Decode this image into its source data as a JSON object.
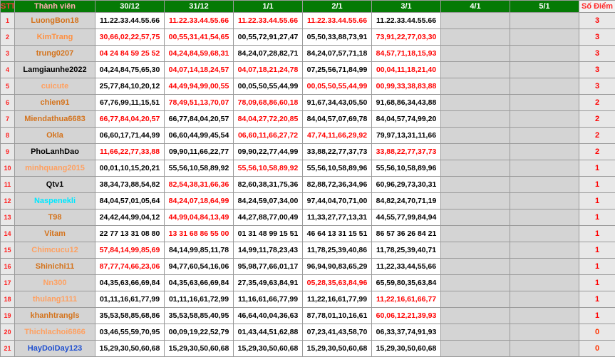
{
  "headers": {
    "stt": "STT",
    "name": "Thành viên",
    "dates": [
      "30/12",
      "31/12",
      "1/1",
      "2/1",
      "3/1",
      "4/1",
      "5/1"
    ],
    "score": "Số Điểm"
  },
  "rows": [
    {
      "stt": "1",
      "name": "LuongBon18",
      "nameColor": "#d4731c",
      "values": [
        "11.22.33.44.55.66",
        "11.22.33.44.55.66",
        "11.22.33.44.55.66",
        "11.22.33.44.55.66",
        "11.22.33.44.55.66"
      ],
      "red": [
        false,
        true,
        true,
        true,
        false
      ],
      "score": "3"
    },
    {
      "stt": "2",
      "name": "KimTrang",
      "nameColor": "#ff9040",
      "values": [
        "30,66,02,22,57,75",
        "00,55,31,41,54,65",
        "00,55,72,91,27,47",
        "05,50,33,88,73,91",
        "73,91,22,77,03,30"
      ],
      "red": [
        true,
        true,
        false,
        false,
        true
      ],
      "score": "3"
    },
    {
      "stt": "3",
      "name": "trung0207",
      "nameColor": "#d4731c",
      "values": [
        "04 24 84 59 25 52",
        "04,24,84,59,68,31",
        "84,24,07,28,82,71",
        "84,24,07,57,71,18",
        "84,57,71,18,15,93"
      ],
      "red": [
        true,
        true,
        false,
        false,
        true
      ],
      "score": "3"
    },
    {
      "stt": "4",
      "name": "Lamgiaunhe2022",
      "nameColor": "#000000",
      "values": [
        "04,24,84,75,65,30",
        "04,07,14,18,24,57",
        "04,07,18,21,24,78",
        "07,25,56,71,84,99",
        "00,04,11,18,21,40"
      ],
      "red": [
        false,
        true,
        true,
        false,
        true
      ],
      "score": "3"
    },
    {
      "stt": "5",
      "name": "cuicute",
      "nameColor": "#ffa060",
      "values": [
        "25,77,84,10,20,12",
        "44,49,94,99,00,55",
        "00,05,50,55,44,99",
        "00,05,50,55,44,99",
        "00,99,33,38,83,88"
      ],
      "red": [
        false,
        true,
        false,
        true,
        true
      ],
      "score": "3"
    },
    {
      "stt": "6",
      "name": "chien91",
      "nameColor": "#d4731c",
      "values": [
        "67,76,99,11,15,51",
        "78,49,51,13,70,07",
        "78,09,68,86,60,18",
        "91,67,34,43,05,50",
        "91,68,86,34,43,88"
      ],
      "red": [
        false,
        true,
        true,
        false,
        false
      ],
      "score": "2"
    },
    {
      "stt": "7",
      "name": "Miendathua6683",
      "nameColor": "#d4731c",
      "values": [
        "66,77,84,04,20,57",
        "66,77,84,04,20,57",
        "84,04,27,72,20,85",
        "84,04,57,07,69,78",
        "84,04,57,74,99,20"
      ],
      "red": [
        true,
        false,
        true,
        false,
        false
      ],
      "score": "2"
    },
    {
      "stt": "8",
      "name": "Okla",
      "nameColor": "#d4731c",
      "values": [
        "06,60,17,71,44,99",
        "06,60,44,99,45,54",
        "06,60,11,66,27,72",
        "47,74,11,66,29,92",
        "79,97,13,31,11,66"
      ],
      "red": [
        false,
        false,
        true,
        true,
        false
      ],
      "score": "2"
    },
    {
      "stt": "9",
      "name": "PhoLanhDao",
      "nameColor": "#000000",
      "values": [
        "11,66,22,77,33,88",
        "09,90,11,66,22,77",
        "09,90,22,77,44,99",
        "33,88,22,77,37,73",
        "33,88,22,77,37,73"
      ],
      "red": [
        true,
        false,
        false,
        false,
        true
      ],
      "score": "2"
    },
    {
      "stt": "10",
      "name": "minhquang2015",
      "nameColor": "#ffa060",
      "values": [
        "00,01,10,15,20,21",
        "55,56,10,58,89,92",
        "55,56,10,58,89,92",
        "55,56,10,58,89,96",
        "55,56,10,58,89,96"
      ],
      "red": [
        false,
        false,
        true,
        false,
        false
      ],
      "score": "1"
    },
    {
      "stt": "11",
      "name": "Qtv1",
      "nameColor": "#000000",
      "values": [
        "38,34,73,88,54,82",
        "82,54,38,31,66,36",
        "82,60,38,31,75,36",
        "82,88,72,36,34,96",
        "60,96,29,73,30,31"
      ],
      "red": [
        false,
        true,
        false,
        false,
        false
      ],
      "score": "1"
    },
    {
      "stt": "12",
      "name": "Naspenekli",
      "nameColor": "#00e8ff",
      "values": [
        "84,04,57,01,05,64",
        "84,24,07,18,64,99",
        "84,24,59,07,34,00",
        "97,44,04,70,71,00",
        "84,82,24,70,71,19"
      ],
      "red": [
        false,
        true,
        false,
        false,
        false
      ],
      "score": "1"
    },
    {
      "stt": "13",
      "name": "T98",
      "nameColor": "#d4731c",
      "values": [
        "24,42,44,99,04,12",
        "44,99,04,84,13,49",
        "44,27,88,77,00,49",
        "11,33,27,77,13,31",
        "44,55,77,99,84,94"
      ],
      "red": [
        false,
        true,
        false,
        false,
        false
      ],
      "score": "1"
    },
    {
      "stt": "14",
      "name": "Vitam",
      "nameColor": "#d4731c",
      "values": [
        "22 77 13 31 08 80",
        "13 31 68 86 55 00",
        "01 31 48 99 15 51",
        "46 64 13 31 15 51",
        "86 57 36 26 84 21"
      ],
      "red": [
        false,
        true,
        false,
        false,
        false
      ],
      "score": "1"
    },
    {
      "stt": "15",
      "name": "Chimcucu12",
      "nameColor": "#ffa060",
      "values": [
        "57,84,14,99,85,69",
        "84,14,99,85,11,78",
        "14,99,11,78,23,43",
        "11,78,25,39,40,86",
        "11,78,25,39,40,71"
      ],
      "red": [
        true,
        false,
        false,
        false,
        false
      ],
      "score": "1"
    },
    {
      "stt": "16",
      "name": "Shinichi11",
      "nameColor": "#d4731c",
      "values": [
        "87,77,74,66,23,06",
        "94,77,60,54,16,06",
        "95,98,77,66,01,17",
        "96,94,90,83,65,29",
        "11,22,33,44,55,66"
      ],
      "red": [
        true,
        false,
        false,
        false,
        false
      ],
      "score": "1"
    },
    {
      "stt": "17",
      "name": "Nn300",
      "nameColor": "#ffa060",
      "values": [
        "04,35,63,66,69,84",
        "04,35,63,66,69,84",
        "27,35,49,63,84,91",
        "05,28,35,63,84,96",
        "65,59,80,35,63,84"
      ],
      "red": [
        false,
        false,
        false,
        true,
        false
      ],
      "score": "1"
    },
    {
      "stt": "18",
      "name": "thulang1111",
      "nameColor": "#ffa060",
      "values": [
        "01,11,16,61,77,99",
        "01,11,16,61,72,99",
        "11,16,61,66,77,99",
        "11,22,16,61,77,99",
        "11,22,16,61,66,77"
      ],
      "red": [
        false,
        false,
        false,
        false,
        true
      ],
      "score": "1"
    },
    {
      "stt": "19",
      "name": "khanhtrangls",
      "nameColor": "#d4731c",
      "values": [
        "35,53,58,85,68,86",
        "35,53,58,85,40,95",
        "46,64,40,04,36,63",
        "87,78,01,10,16,61",
        "60,06,12,21,39,93"
      ],
      "red": [
        false,
        false,
        false,
        false,
        true
      ],
      "score": "1"
    },
    {
      "stt": "20",
      "name": "Thichlachoi6866",
      "nameColor": "#ffa060",
      "values": [
        "03,46,55,59,70,95",
        "00,09,19,22,52,79",
        "01,43,44,51,62,88",
        "07,23,41,43,58,70",
        "06,33,37,74,91,93"
      ],
      "red": [
        false,
        false,
        false,
        false,
        false
      ],
      "score": "0"
    },
    {
      "stt": "21",
      "name": "HayDoiDay123",
      "nameColor": "#2050d0",
      "values": [
        "15,29,30,50,60,68",
        "15,29,30,50,60,68",
        "15,29,30,50,60,68",
        "15,29,30,50,60,68",
        "15,29,30,50,60,68"
      ],
      "red": [
        false,
        false,
        false,
        false,
        false
      ],
      "score": "0"
    }
  ]
}
